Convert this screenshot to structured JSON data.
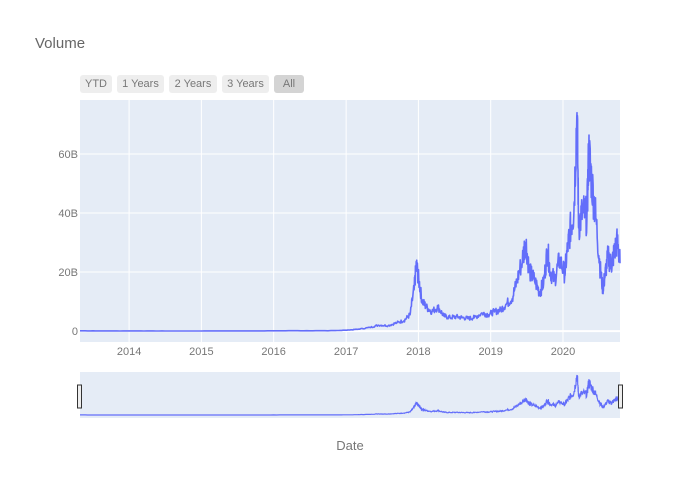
{
  "title": "Volume",
  "range_selector": {
    "buttons": [
      {
        "label": "YTD",
        "active": false
      },
      {
        "label": "1 Years",
        "active": false
      },
      {
        "label": "2 Years",
        "active": false
      },
      {
        "label": "3 Years",
        "active": false
      },
      {
        "label": "All",
        "active": true
      }
    ]
  },
  "colors": {
    "line": "#636efa",
    "plot_bg": "#e5ecf6",
    "grid": "#ffffff"
  },
  "chart_data": {
    "type": "line",
    "title": "Volume",
    "xlabel": "Date",
    "ylabel": "",
    "x_range": [
      "2013-04-28",
      "2020-10-15"
    ],
    "ylim": [
      -3.7,
      78.3
    ],
    "y_unit": "B",
    "y_ticks": [
      0,
      20,
      40,
      60
    ],
    "y_tick_labels": [
      "0",
      "20B",
      "40B",
      "60B"
    ],
    "x_ticks": [
      "2014",
      "2015",
      "2016",
      "2017",
      "2018",
      "2019",
      "2020"
    ],
    "grid": true,
    "legend": "none",
    "rangeslider": true,
    "series": [
      {
        "name": "Volume",
        "x": [
          "2013-04-28",
          "2013-10-01",
          "2014-04-01",
          "2014-10-01",
          "2015-04-01",
          "2015-10-01",
          "2016-04-01",
          "2016-10-01",
          "2017-01-01",
          "2017-03-01",
          "2017-05-01",
          "2017-06-15",
          "2017-08-01",
          "2017-09-15",
          "2017-10-20",
          "2017-11-20",
          "2017-12-10",
          "2017-12-22",
          "2018-01-05",
          "2018-01-20",
          "2018-02-10",
          "2018-03-10",
          "2018-04-10",
          "2018-05-10",
          "2018-06-10",
          "2018-07-10",
          "2018-08-10",
          "2018-09-10",
          "2018-10-10",
          "2018-11-20",
          "2018-12-20",
          "2019-01-20",
          "2019-02-20",
          "2019-03-20",
          "2019-04-20",
          "2019-05-15",
          "2019-06-10",
          "2019-06-27",
          "2019-07-15",
          "2019-08-10",
          "2019-09-05",
          "2019-09-25",
          "2019-10-15",
          "2019-10-28",
          "2019-11-20",
          "2019-12-15",
          "2020-01-10",
          "2020-01-25",
          "2020-02-10",
          "2020-02-25",
          "2020-03-12",
          "2020-03-20",
          "2020-04-10",
          "2020-05-01",
          "2020-05-10",
          "2020-05-25",
          "2020-06-15",
          "2020-07-05",
          "2020-07-20",
          "2020-07-30",
          "2020-08-15",
          "2020-09-01",
          "2020-09-15",
          "2020-10-01",
          "2020-10-15"
        ],
        "values": [
          0.1,
          0.05,
          0.05,
          0.03,
          0.06,
          0.05,
          0.12,
          0.1,
          0.3,
          0.6,
          1.2,
          2.0,
          1.8,
          2.8,
          3.5,
          5.5,
          14,
          22,
          16,
          10,
          8,
          6.5,
          8,
          5,
          4.5,
          4.8,
          4.5,
          4.2,
          4.5,
          6,
          5.5,
          6.5,
          7,
          9,
          11,
          17,
          24,
          30,
          20,
          17,
          13,
          16,
          27,
          20,
          17,
          24,
          19,
          28,
          35,
          40,
          74,
          35,
          40,
          38,
          60,
          50,
          38,
          22,
          14,
          18,
          25,
          22,
          26,
          30,
          23
        ]
      }
    ]
  },
  "axis": {
    "y_tick_labels": [
      "0",
      "20B",
      "40B",
      "60B"
    ],
    "x_tick_labels": [
      "2014",
      "2015",
      "2016",
      "2017",
      "2018",
      "2019",
      "2020"
    ],
    "x_title": "Date"
  }
}
